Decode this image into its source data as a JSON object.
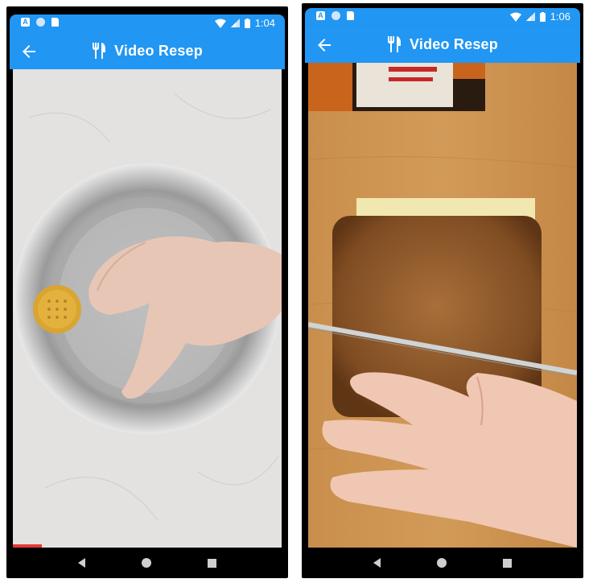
{
  "screens": [
    {
      "time": "1:04",
      "title": "Video Resep"
    },
    {
      "time": "1:06",
      "title": "Video Resep"
    }
  ],
  "colors": {
    "app_bar": "#2196F3",
    "progress": "#e53935"
  },
  "icons": [
    "back-arrow-icon",
    "fork-knife-icon",
    "wifi-icon",
    "signal-icon",
    "battery-icon"
  ]
}
